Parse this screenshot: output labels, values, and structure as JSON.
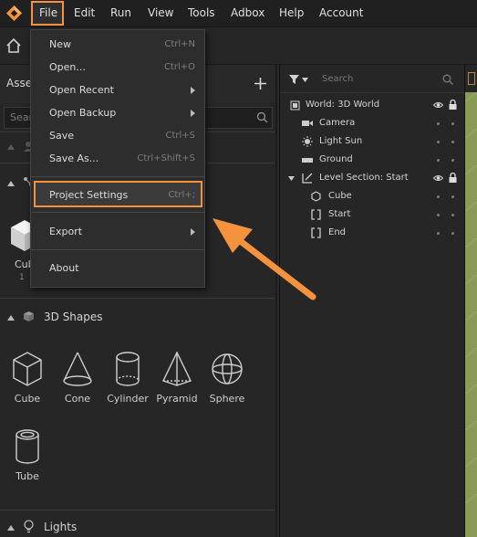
{
  "menubar": {
    "items": [
      "File",
      "Edit",
      "Run",
      "View",
      "Tools",
      "Adbox",
      "Help",
      "Account"
    ]
  },
  "assets_panel": {
    "title": "Asset",
    "search_placeholder": "Sear",
    "cube_label_partial": "Cub",
    "cube_sub_partial": "1"
  },
  "shapes_section": {
    "title": "3D Shapes",
    "items": [
      "Cube",
      "Cone",
      "Cylinder",
      "Pyramid",
      "Sphere",
      "Tube"
    ]
  },
  "lights_section": {
    "title": "Lights"
  },
  "scene_tree": {
    "search_placeholder": "Search",
    "rows": [
      "World: 3D World",
      "Camera",
      "Light Sun",
      "Ground",
      "Level Section: Start",
      "Cube",
      "Start",
      "End"
    ]
  },
  "file_menu": {
    "items": [
      {
        "label": "New",
        "shortcut": "Ctrl+N"
      },
      {
        "label": "Open...",
        "shortcut": "Ctrl+O"
      },
      {
        "label": "Open Recent",
        "shortcut": ""
      },
      {
        "label": "Open Backup",
        "shortcut": ""
      },
      {
        "label": "Save",
        "shortcut": "Ctrl+S"
      },
      {
        "label": "Save As...",
        "shortcut": "Ctrl+Shift+S"
      },
      {
        "label": "Project Settings",
        "shortcut": "Ctrl+;"
      },
      {
        "label": "Export",
        "shortcut": ""
      },
      {
        "label": "About",
        "shortcut": ""
      }
    ]
  },
  "colors": {
    "accent": "#f5923e",
    "viewport": "#8a9a57"
  }
}
